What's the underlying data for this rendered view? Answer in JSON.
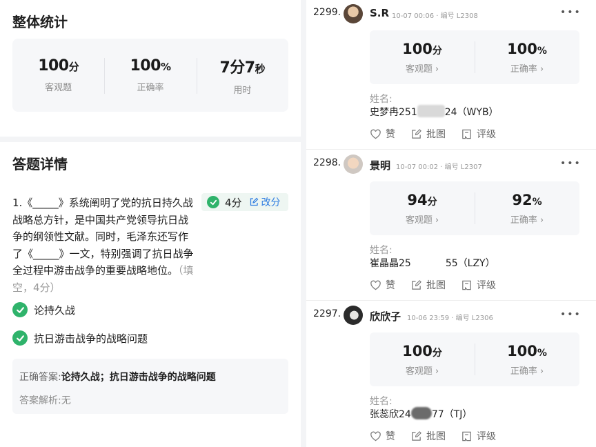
{
  "overall": {
    "title": "整体统计",
    "stats": [
      {
        "value": "100",
        "unit": "分",
        "label": "客观题"
      },
      {
        "value": "100",
        "unit": "%",
        "label": "正确率"
      },
      {
        "value": "7分7",
        "unit": "秒",
        "label": "用时"
      }
    ]
  },
  "details": {
    "title": "答题详情",
    "question": {
      "text": "1.《_____》系统阐明了党的抗日持久战战略总方针，是中国共产党领导抗日战争的纲领性文献。同时，毛泽东还写作了《_____》一文，特别强调了抗日战争全过程中游击战争的重要战略地位。",
      "meta": "（填空，4分）",
      "score": "4分",
      "edit_label": "改分"
    },
    "answers": [
      "论持久战",
      "抗日游击战争的战略问题"
    ],
    "correct_label": "正确答案:",
    "correct_value": "论持久战；抗日游击战争的战略问题",
    "analysis_label": "答案解析:",
    "analysis_value": "无"
  },
  "posts": [
    {
      "rank": "2299.",
      "name": "S.R",
      "time": "10-07 00:06",
      "code": "编号 L2308",
      "more": "•••",
      "score": "100",
      "score_unit": "分",
      "score_label": "客观题",
      "rate": "100",
      "rate_unit": "%",
      "rate_label": "正确率",
      "field_label": "姓名:",
      "name_prefix": "史梦冉251",
      "name_suffix": "24（WYB）",
      "actions": [
        "赞",
        "批图",
        "评级"
      ]
    },
    {
      "rank": "2298.",
      "name": "景明",
      "time": "10-07 00:02",
      "code": "编号 L2307",
      "more": "•••",
      "score": "94",
      "score_unit": "分",
      "score_label": "客观题",
      "rate": "92",
      "rate_unit": "%",
      "rate_label": "正确率",
      "field_label": "姓名:",
      "name_prefix": "崔晶晶25",
      "name_suffix": "55（LZY）",
      "actions": [
        "赞",
        "批图",
        "评级"
      ]
    },
    {
      "rank": "2297.",
      "name": "欣欣子",
      "time": "10-06 23:59",
      "code": "编号 L2306",
      "more": "•••",
      "score": "100",
      "score_unit": "分",
      "score_label": "客观题",
      "rate": "100",
      "rate_unit": "%",
      "rate_label": "正确率",
      "field_label": "姓名:",
      "name_prefix": "张蕊欣24",
      "name_suffix": "77（TJ）",
      "actions": [
        "赞",
        "批图",
        "评级"
      ]
    }
  ],
  "colors": {
    "accent_green": "#2fb36b",
    "link_blue": "#2f7de1",
    "card_bg": "#f6f7f9"
  }
}
